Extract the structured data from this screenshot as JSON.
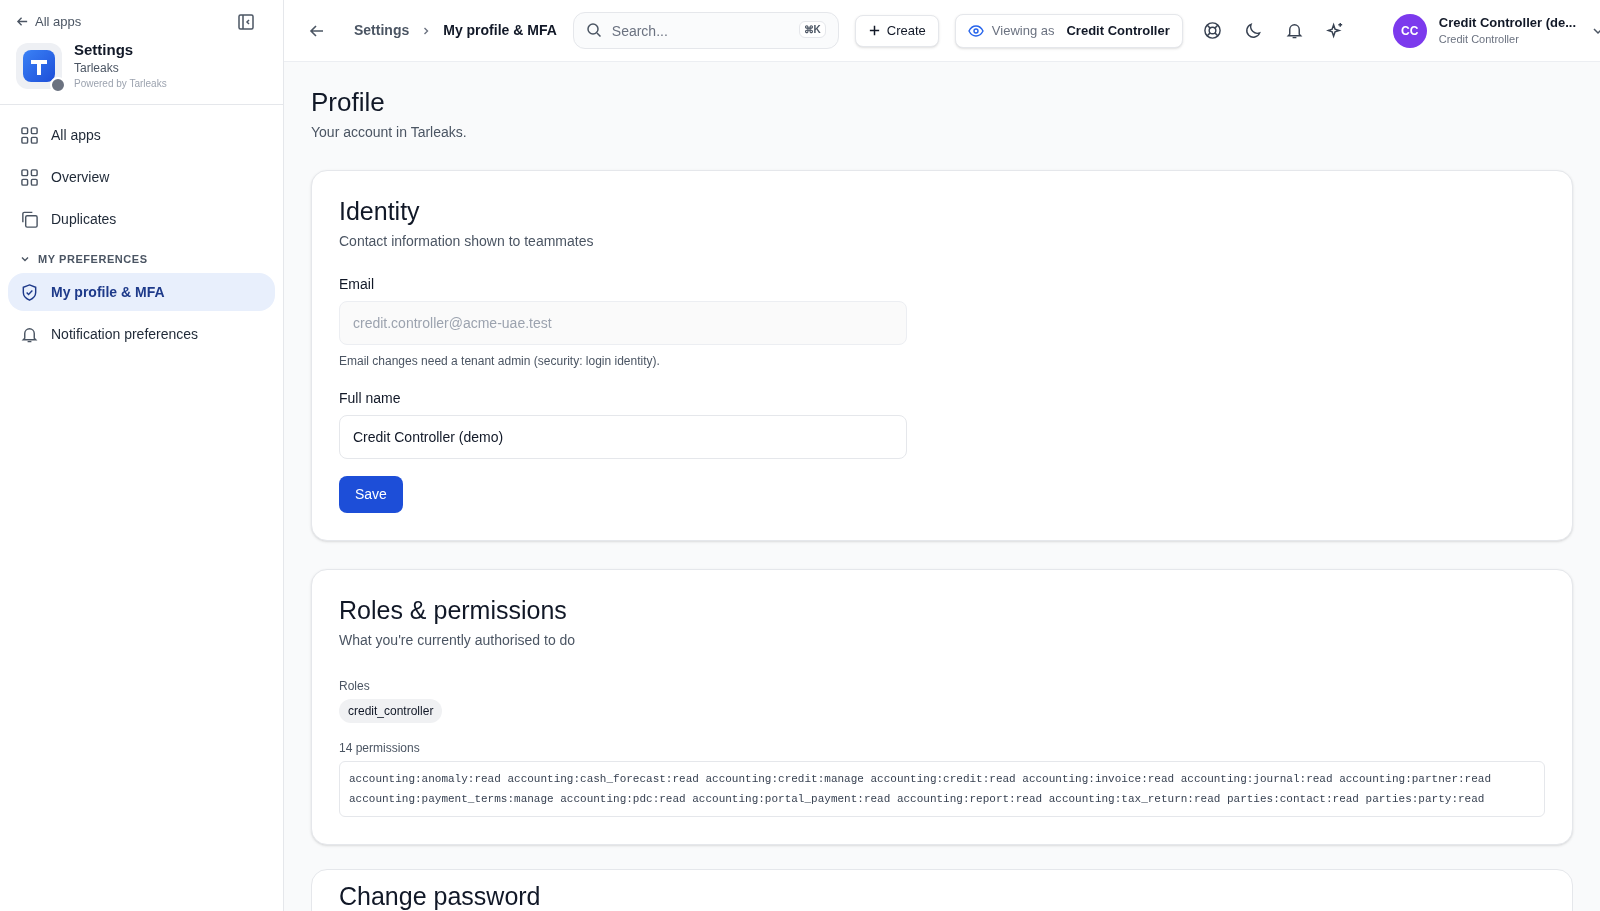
{
  "sidebar": {
    "back_link": "All apps",
    "app": {
      "name": "Settings",
      "tenant": "Tarleaks",
      "powered_by": "Powered by Tarleaks"
    },
    "items": [
      {
        "label": "All apps",
        "selected": false
      },
      {
        "label": "Overview",
        "selected": false
      },
      {
        "label": "Duplicates",
        "selected": false
      }
    ],
    "section": {
      "title": "MY PREFERENCES",
      "expanded": true,
      "items": [
        {
          "label": "My profile & MFA",
          "selected": true
        },
        {
          "label": "Notification preferences",
          "selected": false
        }
      ]
    }
  },
  "topbar": {
    "breadcrumb": [
      "Settings",
      "My profile & MFA"
    ],
    "search": {
      "placeholder": "Search...",
      "shortcut": "⌘K"
    },
    "create_button": "Create",
    "viewing_as": {
      "label": "Viewing as",
      "role": "Credit Controller"
    },
    "user": {
      "initials": "CC",
      "name": "Credit Controller (de...",
      "role": "Credit Controller"
    }
  },
  "page": {
    "title": "Profile",
    "subtitle": "Your account in Tarleaks."
  },
  "identity": {
    "title": "Identity",
    "subtitle": "Contact information shown to teammates",
    "fields": [
      {
        "label": "Email",
        "value": "credit.controller@acme-uae.test",
        "disabled": true,
        "hint": "Email changes need a tenant admin (security: login identity)."
      },
      {
        "label": "Full name",
        "value": "Credit Controller (demo)",
        "disabled": false
      }
    ],
    "save_button": "Save"
  },
  "roles": {
    "title": "Roles & permissions",
    "subtitle": "What you're currently authorised to do",
    "roles_label": "Roles",
    "roles": [
      "credit_controller"
    ],
    "permissions_label": "14 permissions",
    "permissions": [
      "accounting:anomaly:read",
      "accounting:cash_forecast:read",
      "accounting:credit:manage",
      "accounting:credit:read",
      "accounting:invoice:read",
      "accounting:journal:read",
      "accounting:partner:read",
      "accounting:payment_terms:manage",
      "accounting:pdc:read",
      "accounting:portal_payment:read",
      "accounting:report:read",
      "accounting:tax_return:read",
      "parties:contact:read",
      "parties:party:read"
    ]
  },
  "password": {
    "title": "Change password"
  }
}
